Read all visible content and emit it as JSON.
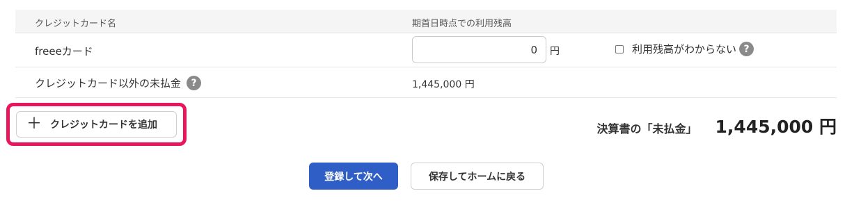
{
  "table": {
    "header": {
      "card_name": "クレジットカード名",
      "balance": "期首日時点での利用残高"
    },
    "rows": [
      {
        "name": "freeeカード",
        "input_value": "0",
        "unit": "円",
        "unknown_checkbox_label": "利用残高がわからない",
        "unknown_checked": false
      }
    ],
    "other": {
      "name": "クレジットカード以外の未払金",
      "value": "1,445,000 円"
    }
  },
  "add_card_button": {
    "label": "クレジットカードを追加",
    "icon": "plus-icon"
  },
  "total": {
    "label": "決算書の「未払金」",
    "value": "1,445,000 円"
  },
  "actions": {
    "primary": "登録して次へ",
    "secondary": "保存してホームに戻る"
  },
  "help_icon_glyph": "?",
  "colors": {
    "primary": "#2f5fc6",
    "highlight": "#e8175d",
    "header_bg": "#f5f5f5",
    "help_icon": "#8a8a8a"
  }
}
